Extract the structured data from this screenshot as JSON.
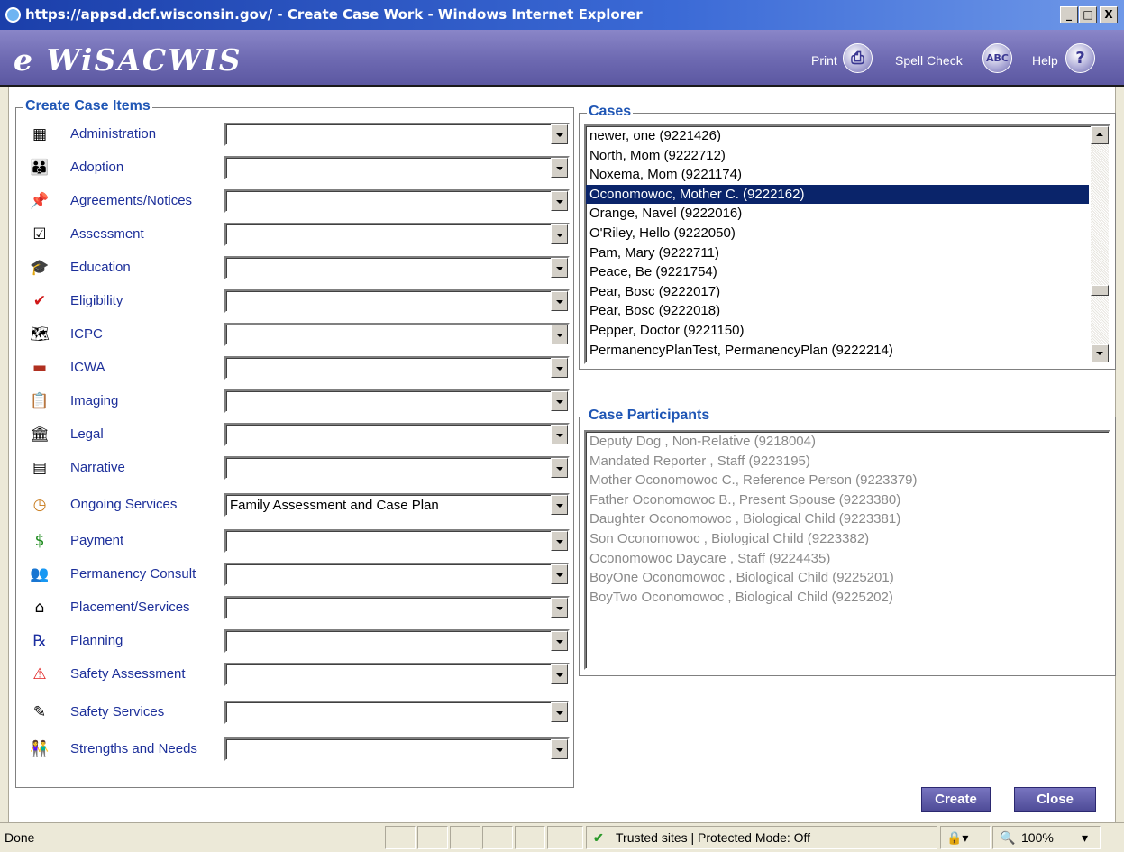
{
  "window": {
    "title": "https://appsd.dcf.wisconsin.gov/ - Create Case Work - Windows Internet Explorer",
    "min": "_",
    "max": "□",
    "close": "X"
  },
  "header": {
    "logo": "e WiSACWIS",
    "print": "Print",
    "spell_check": "Spell Check",
    "help": "Help"
  },
  "create_case_items": {
    "legend": "Create Case Items",
    "items": [
      {
        "label": "Administration",
        "icon": "building-icon",
        "value": ""
      },
      {
        "label": "Adoption",
        "icon": "family-icon",
        "value": ""
      },
      {
        "label": "Agreements/Notices",
        "icon": "pushpin-icon",
        "value": ""
      },
      {
        "label": "Assessment",
        "icon": "checklist-icon",
        "value": ""
      },
      {
        "label": "Education",
        "icon": "graduation-cap-icon",
        "value": ""
      },
      {
        "label": "Eligibility",
        "icon": "checkmark-icon",
        "value": ""
      },
      {
        "label": "ICPC",
        "icon": "map-icon",
        "value": ""
      },
      {
        "label": "ICWA",
        "icon": "flag-icon",
        "value": ""
      },
      {
        "label": "Imaging",
        "icon": "clipboard-icon",
        "value": ""
      },
      {
        "label": "Legal",
        "icon": "courthouse-icon",
        "value": ""
      },
      {
        "label": "Narrative",
        "icon": "document-icon",
        "value": ""
      },
      {
        "label": "Ongoing Services",
        "icon": "clock-icon",
        "value": "Family Assessment and Case Plan"
      },
      {
        "label": "Payment",
        "icon": "dollar-icon",
        "value": ""
      },
      {
        "label": "Permanency Consult",
        "icon": "people-icon",
        "value": ""
      },
      {
        "label": "Placement/Services",
        "icon": "house-icon",
        "value": ""
      },
      {
        "label": "Planning",
        "icon": "prescription-icon",
        "value": ""
      },
      {
        "label": "Safety Assessment",
        "icon": "warning-triangle-icon",
        "value": ""
      },
      {
        "label": "Safety Services",
        "icon": "pen-icon",
        "value": ""
      },
      {
        "label": "Strengths and Needs",
        "icon": "people-pair-icon",
        "value": ""
      }
    ]
  },
  "cases": {
    "legend": "Cases",
    "items": [
      "newer, one (9221426)",
      "North, Mom (9222712)",
      "Noxema, Mom (9221174)",
      "Oconomowoc, Mother C. (9222162)",
      "Orange, Navel (9222016)",
      "O'Riley, Hello (9222050)",
      "Pam, Mary (9222711)",
      "Peace, Be (9221754)",
      "Pear, Bosc (9222017)",
      "Pear, Bosc (9222018)",
      "Pepper, Doctor (9221150)",
      "PermanencyPlanTest, PermanencyPlan (9222214)"
    ],
    "selected_index": 3
  },
  "case_participants": {
    "legend": "Case Participants",
    "items": [
      "Deputy Dog , Non-Relative (9218004)",
      "Mandated Reporter , Staff (9223195)",
      "Mother Oconomowoc C., Reference Person (9223379)",
      "Father Oconomowoc B., Present Spouse (9223380)",
      "Daughter Oconomowoc , Biological Child (9223381)",
      "Son Oconomowoc , Biological Child (9223382)",
      "Oconomowoc Daycare , Staff (9224435)",
      "BoyOne Oconomowoc , Biological Child (9225201)",
      "BoyTwo Oconomowoc , Biological Child (9225202)"
    ]
  },
  "actions": {
    "create": "Create",
    "close": "Close"
  },
  "statusbar": {
    "status": "Done",
    "zone": "Trusted sites | Protected Mode: Off",
    "zoom": "100%"
  }
}
